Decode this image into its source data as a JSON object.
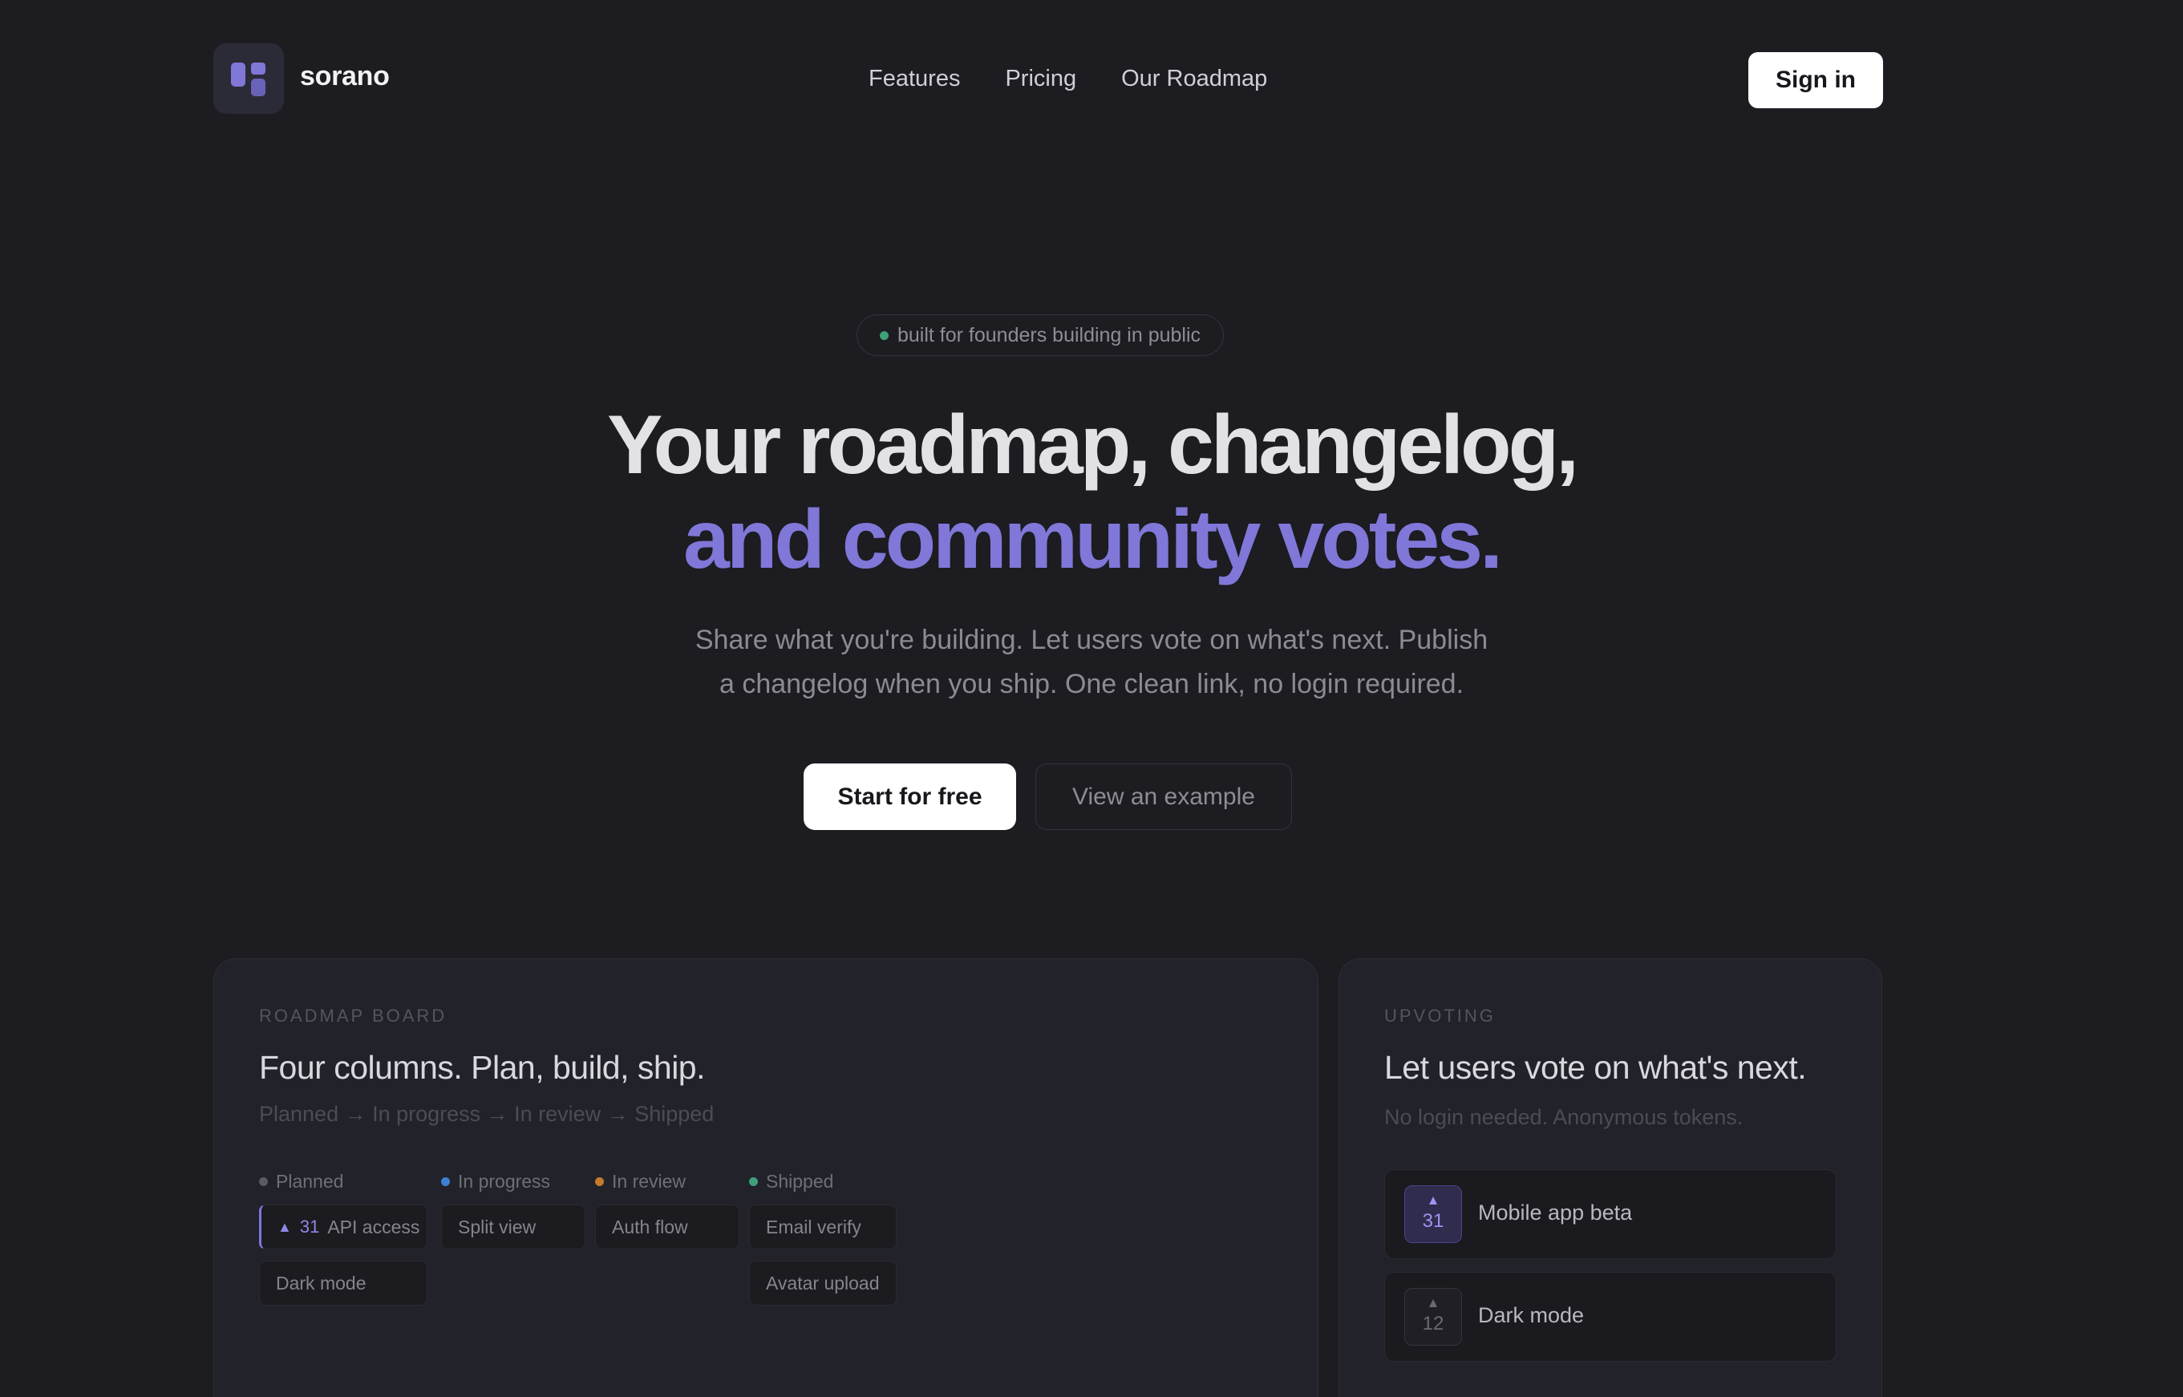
{
  "nav": {
    "brand": "sorano",
    "links": [
      "Features",
      "Pricing",
      "Our Roadmap"
    ],
    "signin_label": "Sign in"
  },
  "hero": {
    "badge": "built for founders building in public",
    "title_line1": "Your roadmap, changelog,",
    "title_line2": "and community votes.",
    "sub_line1": "Share what you're building. Let users vote on what's next. Publish",
    "sub_line2": "a changelog when you ship. One clean link, no login required.",
    "cta_primary": "Start for free",
    "cta_secondary": "View an example"
  },
  "roadmap_card": {
    "eyebrow": "ROADMAP BOARD",
    "title": "Four columns. Plan, build, ship.",
    "subtitle": "Planned → In progress → In review → Shipped",
    "columns": [
      {
        "name": "Planned",
        "dot_color": "#5a5a63",
        "items": [
          "API access",
          "Dark mode"
        ],
        "active_votes": "31"
      },
      {
        "name": "In progress",
        "dot_color": "#3f7fd6",
        "items": [
          "Split view"
        ]
      },
      {
        "name": "In review",
        "dot_color": "#c77a2a",
        "items": [
          "Auth flow"
        ]
      },
      {
        "name": "Shipped",
        "dot_color": "#3fa07a",
        "items": [
          "Email verify",
          "Avatar upload"
        ]
      }
    ]
  },
  "upvote_card": {
    "eyebrow": "UPVOTING",
    "title": "Let users vote on what's next.",
    "subtitle": "No login needed. Anonymous tokens.",
    "items": [
      {
        "count": "31",
        "label": "Mobile app beta",
        "voted": true
      },
      {
        "count": "12",
        "label": "Dark mode",
        "voted": false
      }
    ]
  },
  "colors": {
    "background": "#1c1c21",
    "accent": "#8077d8"
  }
}
